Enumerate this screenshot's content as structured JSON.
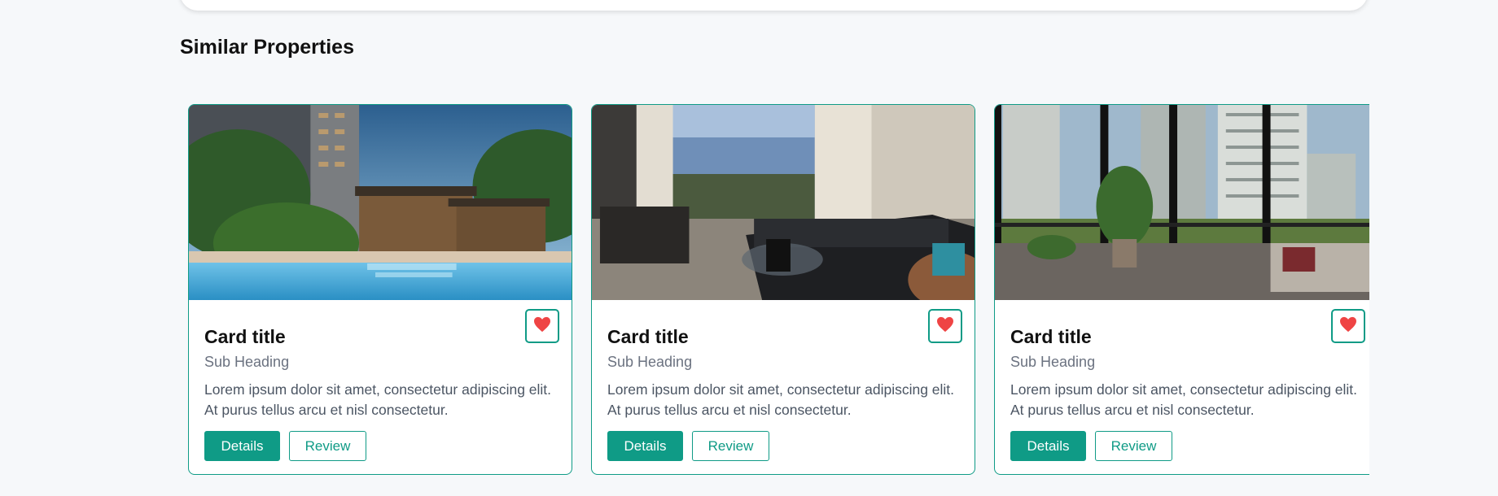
{
  "section": {
    "title": "Similar Properties"
  },
  "colors": {
    "accent": "#0f9b86",
    "heart": "#ef4444"
  },
  "cards": [
    {
      "image": "rooftop-garden-pool-photo",
      "title": "Card title",
      "subtitle": "Sub Heading",
      "text": "Lorem ipsum dolor sit amet, consectetur adipiscing elit. At purus tellus arcu et nisl consectetur.",
      "details_label": "Details",
      "review_label": "Review",
      "favorite_icon": "heart-icon"
    },
    {
      "image": "living-room-sofa-photo",
      "title": "Card title",
      "subtitle": "Sub Heading",
      "text": "Lorem ipsum dolor sit amet, consectetur adipiscing elit. At purus tellus arcu et nisl consectetur.",
      "details_label": "Details",
      "review_label": "Review",
      "favorite_icon": "heart-icon"
    },
    {
      "image": "balcony-city-view-photo",
      "title": "Card title",
      "subtitle": "Sub Heading",
      "text": "Lorem ipsum dolor sit amet, consectetur adipiscing elit. At purus tellus arcu et nisl consectetur.",
      "details_label": "Details",
      "review_label": "Review",
      "favorite_icon": "heart-icon"
    }
  ]
}
